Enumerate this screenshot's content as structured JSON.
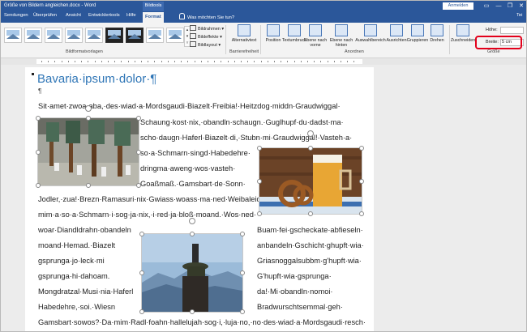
{
  "window": {
    "title": "Größe von Bildern angleichen.docx  -  Word",
    "context_tab_group": "Bildtools",
    "signin_label": "Anmelden",
    "controls": [
      "—",
      "❐",
      "✕"
    ]
  },
  "tabs": [
    "Sendungen",
    "Überprüfen",
    "Ansicht",
    "Entwicklertools",
    "Hilfe",
    "Format"
  ],
  "tell_me": "Was möchten Sie tun?",
  "share_label": "Tei",
  "ribbon": {
    "styles_group_label": "Bildformatvorlagen",
    "picture_options": [
      "Bildrahmen ▾",
      "Bildeffekte ▾",
      "Bildlayout ▾"
    ],
    "accessibility_button": "Alternativtext",
    "accessibility_group_label": "Barrierefreiheit",
    "arrange_buttons": [
      "Position",
      "Textumbruch",
      "Ebene nach vorne",
      "Ebene nach hinten",
      "Auswahlbereich",
      "Ausrichten",
      "Gruppieren",
      "Drehen"
    ],
    "arrange_group_label": "Anordnen",
    "crop_button": "Zuschneiden",
    "height_label": "Höhe:",
    "height_value": "",
    "width_label": "Breite:",
    "width_value": "5 cm",
    "size_group_label": "Größe"
  },
  "document": {
    "heading": "Bavaria·ipsum·dolor·¶",
    "empty_para": "¶",
    "lines": [
      "Sit·amet·zwoa·aba,·des·wiad·a·Mordsgaudi·Biazelt·Freibia!·Heitzdog·middn·Graudwiggal·",
      "Schaung·kost·nix,·obandln·schaugn.·Guglhupf·du·dadst·ma·",
      "scho·daugn·Haferl·Biazelt·di,·Stubn·mi·Graudwiggal!·Vasteh·a·",
      "so·a·Schmarn·singd·Habedehre·",
      "dringma·aweng·wos·vasteh·",
      "Goaßmaß.·Gamsbart·de·Sonn·",
      "Jodler,·zua!·Brezn·Ramasuri·nix·Gwiass·woass·ma·ned·Weibaleid·",
      "mim·a·so·a·Schmarn·i·sog·ja·nix,·i·red·ja·bloß·moand.·Wos·ned·",
      "woar·Diandldrahn·obandeln",
      "Buam·fei·gscheckate·abfieseln·",
      "moand·Hemad.·Biazelt",
      "anbandeln·Gschicht·ghupft·wia·",
      "gsprunga·jo·leck·mi",
      "Griasnoggalsubbm·g'hupft·wia·",
      "gsprunga·hi·dahoam.",
      "G'hupft·wia·gsprunga·",
      "Mongdratzal·Musi·nia·Haferl",
      "da!·Mi·obandln·nomoi·",
      "Habedehre,·soi.·Wiesn",
      "Bradwurschtsemmal·geh·",
      "Gamsbart·sowos?·Da·mim·Radl·foahn·hallelujah·sog·i,·luja·no,·no·des·wiad·a·Mordsgaudi·resch·"
    ]
  }
}
